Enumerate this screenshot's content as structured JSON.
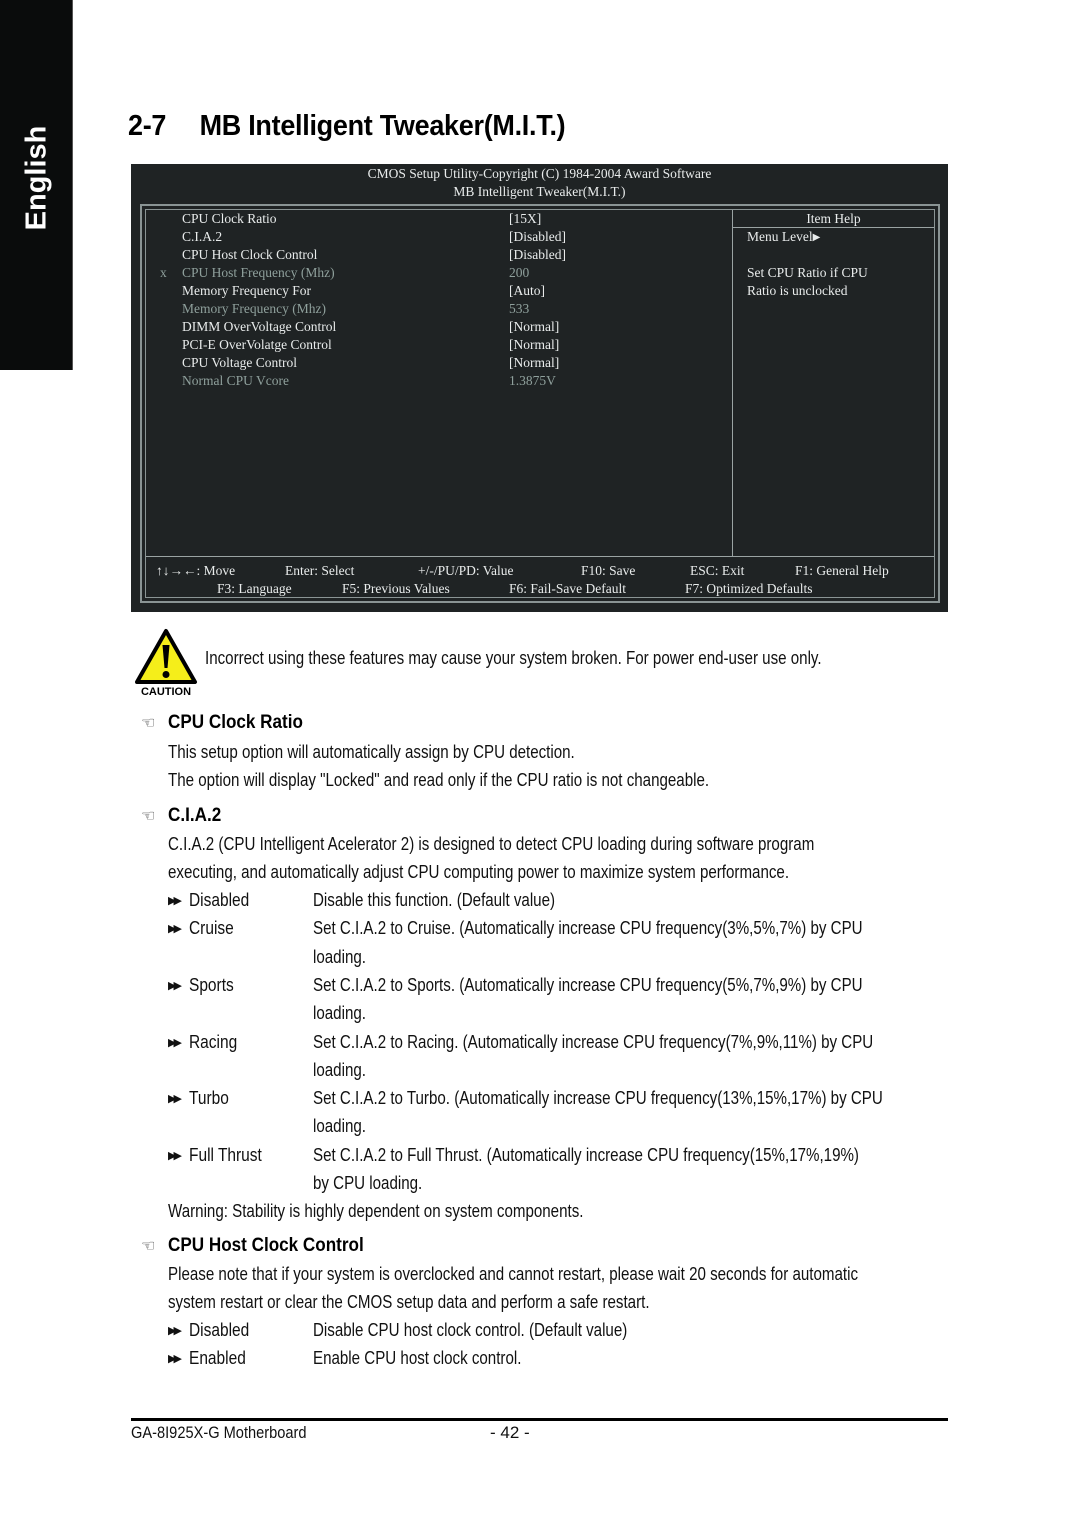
{
  "side_tab": {
    "label": "English"
  },
  "page_title": {
    "number": "2-7",
    "text": "MB Intelligent Tweaker(M.I.T.)"
  },
  "bios": {
    "header_line1": "CMOS Setup Utility-Copyright (C) 1984-2004 Award Software",
    "header_line2": "MB Intelligent Tweaker(M.I.T.)",
    "items": [
      {
        "mark": "",
        "label": "CPU Clock Ratio",
        "value": "[15X]",
        "disabled": false
      },
      {
        "mark": "",
        "label": "C.I.A.2",
        "value": "[Disabled]",
        "disabled": false
      },
      {
        "mark": "",
        "label": "CPU Host Clock Control",
        "value": "[Disabled]",
        "disabled": false
      },
      {
        "mark": "x",
        "label": "CPU Host Frequency (Mhz)",
        "value": "200",
        "disabled": true
      },
      {
        "mark": "",
        "label": "Memory Frequency For",
        "value": "[Auto]",
        "disabled": false
      },
      {
        "mark": "",
        "label": "Memory Frequency (Mhz)",
        "value": "533",
        "disabled": true
      },
      {
        "mark": "",
        "label": "DIMM OverVoltage Control",
        "value": "[Normal]",
        "disabled": false
      },
      {
        "mark": "",
        "label": "PCI-E OverVolatge Control",
        "value": "[Normal]",
        "disabled": false
      },
      {
        "mark": "",
        "label": "CPU Voltage Control",
        "value": "[Normal]",
        "disabled": false
      },
      {
        "mark": "",
        "label": "Normal CPU Vcore",
        "value": "1.3875V",
        "disabled": true
      }
    ],
    "help": {
      "title": "Item Help",
      "menu_level": "Menu Level",
      "lines": [
        "Set CPU Ratio if CPU",
        "Ratio is unclocked"
      ]
    },
    "keys_row1": [
      "↑↓→←: Move",
      "Enter: Select",
      "+/-/PU/PD: Value",
      "F10: Save",
      "ESC: Exit",
      "F1: General Help"
    ],
    "keys_row2": [
      "F3: Language",
      "F5: Previous Values",
      "F6: Fail-Save Default",
      "F7: Optimized Defaults"
    ]
  },
  "caution": {
    "label": "CAUTION",
    "text": "Incorrect using these features may cause your system broken. For power end-user use only."
  },
  "sections": {
    "cpu_clock_ratio": {
      "title": "CPU Clock Ratio",
      "lines": [
        "This setup option will automatically assign by CPU detection.",
        "The option will display \"Locked\" and read only if the CPU ratio is not changeable."
      ]
    },
    "cia2": {
      "title": "C.I.A.2",
      "lines": [
        "C.I.A.2 (CPU Intelligent Acelerator 2) is designed to detect CPU loading during software program",
        "executing, and automatically adjust CPU computing power to maximize system performance."
      ],
      "options": [
        {
          "name": "Disabled",
          "desc": [
            "Disable this function. (Default value)"
          ]
        },
        {
          "name": "Cruise",
          "desc": [
            "Set C.I.A.2 to Cruise. (Automatically increase CPU frequency(3%,5%,7%) by CPU",
            "loading."
          ]
        },
        {
          "name": "Sports",
          "desc": [
            "Set C.I.A.2 to Sports. (Automatically increase CPU frequency(5%,7%,9%) by CPU",
            "loading."
          ]
        },
        {
          "name": "Racing",
          "desc": [
            "Set C.I.A.2 to Racing. (Automatically increase CPU frequency(7%,9%,11%) by CPU",
            "loading."
          ]
        },
        {
          "name": "Turbo",
          "desc": [
            "Set C.I.A.2 to Turbo. (Automatically increase CPU frequency(13%,15%,17%) by CPU",
            "loading."
          ]
        },
        {
          "name": "Full Thrust",
          "desc": [
            "Set C.I.A.2 to Full Thrust. (Automatically increase CPU frequency(15%,17%,19%)",
            "by CPU loading."
          ]
        }
      ],
      "warning": "Warning: Stability is highly dependent on system components."
    },
    "cpu_host_clock": {
      "title": "CPU Host Clock Control",
      "lines": [
        "Please note that if your system is overclocked and cannot restart, please wait 20 seconds for automatic",
        "system restart or clear the CMOS setup data and perform a safe restart."
      ],
      "options": [
        {
          "name": "Disabled",
          "desc": [
            "Disable CPU host clock control. (Default value)"
          ]
        },
        {
          "name": "Enabled",
          "desc": [
            "Enable CPU host clock control."
          ]
        }
      ]
    }
  },
  "footer": {
    "model": "GA-8I925X-G Motherboard",
    "page": "- 42 -"
  }
}
